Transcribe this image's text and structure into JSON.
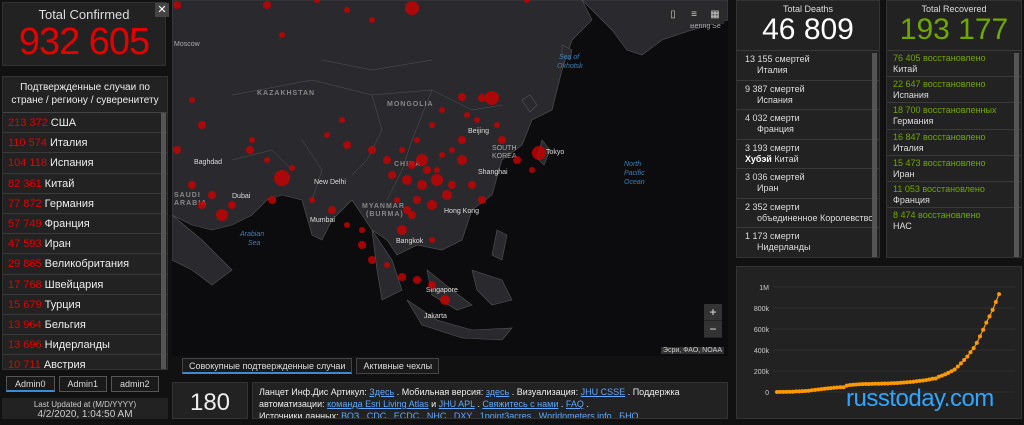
{
  "total_confirmed": {
    "label": "Total Confirmed",
    "value": "932 605",
    "close": "✕"
  },
  "country_panel": {
    "header": "Подтвержденные случаи по стране / региону / суверенитету",
    "rows": [
      {
        "value": "213 372",
        "name": "США"
      },
      {
        "value": "110 574",
        "name": "Италия"
      },
      {
        "value": "104 118",
        "name": "Испания"
      },
      {
        "value": "82 361",
        "name": "Китай"
      },
      {
        "value": "77 872",
        "name": "Германия"
      },
      {
        "value": "57 749",
        "name": "Франция"
      },
      {
        "value": "47 593",
        "name": "Иран"
      },
      {
        "value": "29 865",
        "name": "Великобритания"
      },
      {
        "value": "17 768",
        "name": "Швейцария"
      },
      {
        "value": "15 679",
        "name": "Турция"
      },
      {
        "value": "13 964",
        "name": "Бельгия"
      },
      {
        "value": "13 696",
        "name": "Нидерланды"
      },
      {
        "value": "10 711",
        "name": "Австрия"
      }
    ]
  },
  "admin_tabs": [
    "Admin0",
    "Admin1",
    "admin2"
  ],
  "last_updated": {
    "label": "Last Updated at (M/D/YYYY)",
    "value": "4/2/2020, 1:04:50 AM"
  },
  "map": {
    "labels": {
      "moscow": "Moscow",
      "kazakhstan": "KAZAKHSTAN",
      "mongolia": "MONGOLIA",
      "china": "CHINA",
      "sea_okhotsk_1": "Sea of",
      "sea_okhotsk_2": "Okhotsk",
      "beijing": "Beijing",
      "south_korea_1": "SOUTH",
      "south_korea_2": "KOREA",
      "tokyo": "Tokyo",
      "shanghai": "Shanghai",
      "north_pacific_1": "North",
      "north_pacific_2": "Pacific",
      "north_pacific_3": "Ocean",
      "baghdad": "Baghdad",
      "saudi_1": "SAUDI",
      "saudi_2": "ARABIA",
      "dubai": "Dubai",
      "new_delhi": "New Delhi",
      "mumbai": "Mumbai",
      "arabian_sea_1": "Arabian",
      "arabian_sea_2": "Sea",
      "myanmar_1": "MYANMAR",
      "myanmar_2": "(BURMA)",
      "hong_kong": "Hong Kong",
      "bangkok": "Bangkok",
      "singapore": "Singapore",
      "jakarta": "Jakarta",
      "bering": "Bering Se"
    },
    "attribution": "Эсри, ФАО, NOAA",
    "tools": [
      "bookmark-icon",
      "list-icon",
      "grid-icon"
    ],
    "zoom_in": "+",
    "zoom_out": "−"
  },
  "map_tabs": [
    "Совокупные подтвержденные случаи",
    "Активные чехлы"
  ],
  "count_box": {
    "value": "180"
  },
  "info": {
    "l1_a": "Ланцет Инф.Дис  Артикул: ",
    "l1_link1": "Здесь",
    "l1_b": " . Мобильная версия: ",
    "l1_link2": "здесь",
    "l1_c": " . Визуализация: ",
    "l1_link3": "JHU CSSE",
    "l1_d": " . Поддержка",
    "l2_a": "автоматизации: ",
    "l2_link1": "команда Esri Living Atlas",
    "l2_b": "  и  ",
    "l2_link2": "JHU APL",
    "l2_c": " . ",
    "l2_link3": "Свяжитесь с нами",
    "l2_d": " . ",
    "l2_link4": "FAQ",
    "l2_e": " .",
    "l3_a": "Источники данных: ",
    "l3_link1": "ВОЗ",
    "l3_b": " , ",
    "l3_link2": "CDC",
    "l3_c": " , ",
    "l3_link3": "ECDC",
    "l3_d": " , ",
    "l3_link4": "NHC",
    "l3_e": " , ",
    "l3_link5": "DXY",
    "l3_f": " , ",
    "l3_link6": "1point3acres",
    "l3_g": " , ",
    "l3_link7": "Worldometers.info",
    "l3_h": " , ",
    "l3_link8": "БНО",
    "l3_i": " ,"
  },
  "deaths": {
    "label": "Total Deaths",
    "value": "46 809",
    "rows": [
      {
        "value": "13 155",
        "unit": "смертей",
        "place": "Италия"
      },
      {
        "value": "9 387",
        "unit": "смертей",
        "place": "Испания"
      },
      {
        "value": "4 032",
        "unit": "смерти",
        "place": "Франция"
      },
      {
        "value": "3 193",
        "unit": "смерти",
        "place_bold": "Хубэй",
        "place": "Китай"
      },
      {
        "value": "3 036",
        "unit": "смертей",
        "place": "Иран"
      },
      {
        "value": "2 352",
        "unit": "смерти",
        "place": "объединенное Королевство"
      },
      {
        "value": "1 173",
        "unit": "смерти",
        "place": "Нидерланды"
      }
    ]
  },
  "recovered": {
    "label": "Total Recovered",
    "value": "193 177",
    "rows": [
      {
        "value": "76 405",
        "unit": "восстановлено",
        "place": "Китай"
      },
      {
        "value": "22 647",
        "unit": "восстановлено",
        "place": "Испания"
      },
      {
        "value": "18 700",
        "unit": "восстановленных",
        "place": "Германия"
      },
      {
        "value": "16 847",
        "unit": "восстановлено",
        "place": "Италия"
      },
      {
        "value": "15 473",
        "unit": "восстановлено",
        "place": "Иран"
      },
      {
        "value": "11 053",
        "unit": "восстановлено",
        "place": "Франция"
      },
      {
        "value": "8 474",
        "unit": "восстановлено",
        "place": "НАС"
      }
    ]
  },
  "chart_data": {
    "type": "line",
    "ylim": [
      0,
      1000000
    ],
    "yticks": [
      "0",
      "200k",
      "400k",
      "600k",
      "800k",
      "1M"
    ],
    "ytick_values": [
      0,
      200000,
      400000,
      600000,
      800000,
      1000000
    ],
    "color": "#ff9900",
    "values": [
      555,
      654,
      941,
      1434,
      2118,
      2927,
      5578,
      6166,
      8234,
      9927,
      12038,
      16787,
      19881,
      23892,
      27635,
      30817,
      34391,
      37120,
      40150,
      42762,
      44802,
      45221,
      60368,
      66885,
      69030,
      71224,
      73258,
      75136,
      75639,
      76197,
      76819,
      78572,
      78958,
      79561,
      80406,
      81388,
      82746,
      84112,
      86011,
      88369,
      90306,
      92840,
      95120,
      97886,
      101801,
      105847,
      109821,
      113590,
      118620,
      125875,
      128352,
      145205,
      156101,
      167454,
      181574,
      197102,
      214821,
      242570,
      272208,
      304507,
      336953,
      378235,
      418045,
      467653,
      529591,
      593291,
      660706,
      720117,
      782365,
      857487,
      932605
    ]
  },
  "watermark": "russtoday.com"
}
